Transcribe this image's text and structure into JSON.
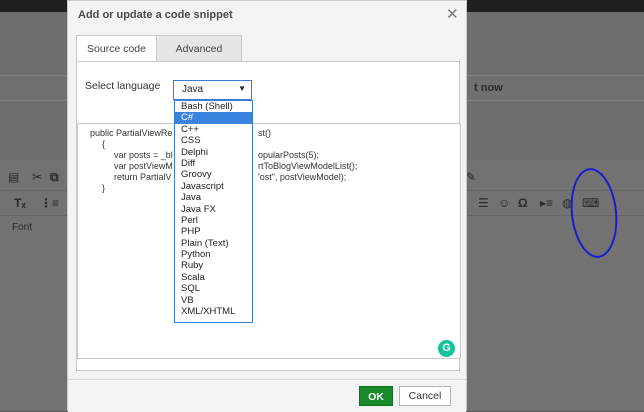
{
  "dialog": {
    "title": "Add or update a code snippet",
    "close_symbol": "✕",
    "tabs": [
      {
        "label": "Source code",
        "active": true
      },
      {
        "label": "Advanced",
        "active": false
      }
    ],
    "language_label": "Select language",
    "selected_language": "Java",
    "languages": [
      "Bash (Shell)",
      "C#",
      "C++",
      "CSS",
      "Delphi",
      "Diff",
      "Groovy",
      "Javascript",
      "Java",
      "Java FX",
      "Perl",
      "PHP",
      "Plain (Text)",
      "Python",
      "Ruby",
      "Scala",
      "SQL",
      "VB",
      "XML/XHTML"
    ],
    "highlighted_option": "C#",
    "code_lines": [
      "public PartialViewRe",
      "{",
      "var posts = _bl",
      "var postViewM",
      "return PartialV",
      "}"
    ],
    "code_lines_right": [
      "st()",
      "opularPosts(5);",
      "rtToBlogViewModelList();",
      "'ost\", postViewModel);"
    ],
    "ok_label": "OK",
    "cancel_label": "Cancel",
    "grammarly_letter": "G"
  },
  "background": {
    "partial_title": "t now",
    "font_label": "Font"
  },
  "colors": {
    "ok_button": "#178a2c",
    "selection": "#3a84e0",
    "annotation_circle": "#1a1ad6"
  }
}
